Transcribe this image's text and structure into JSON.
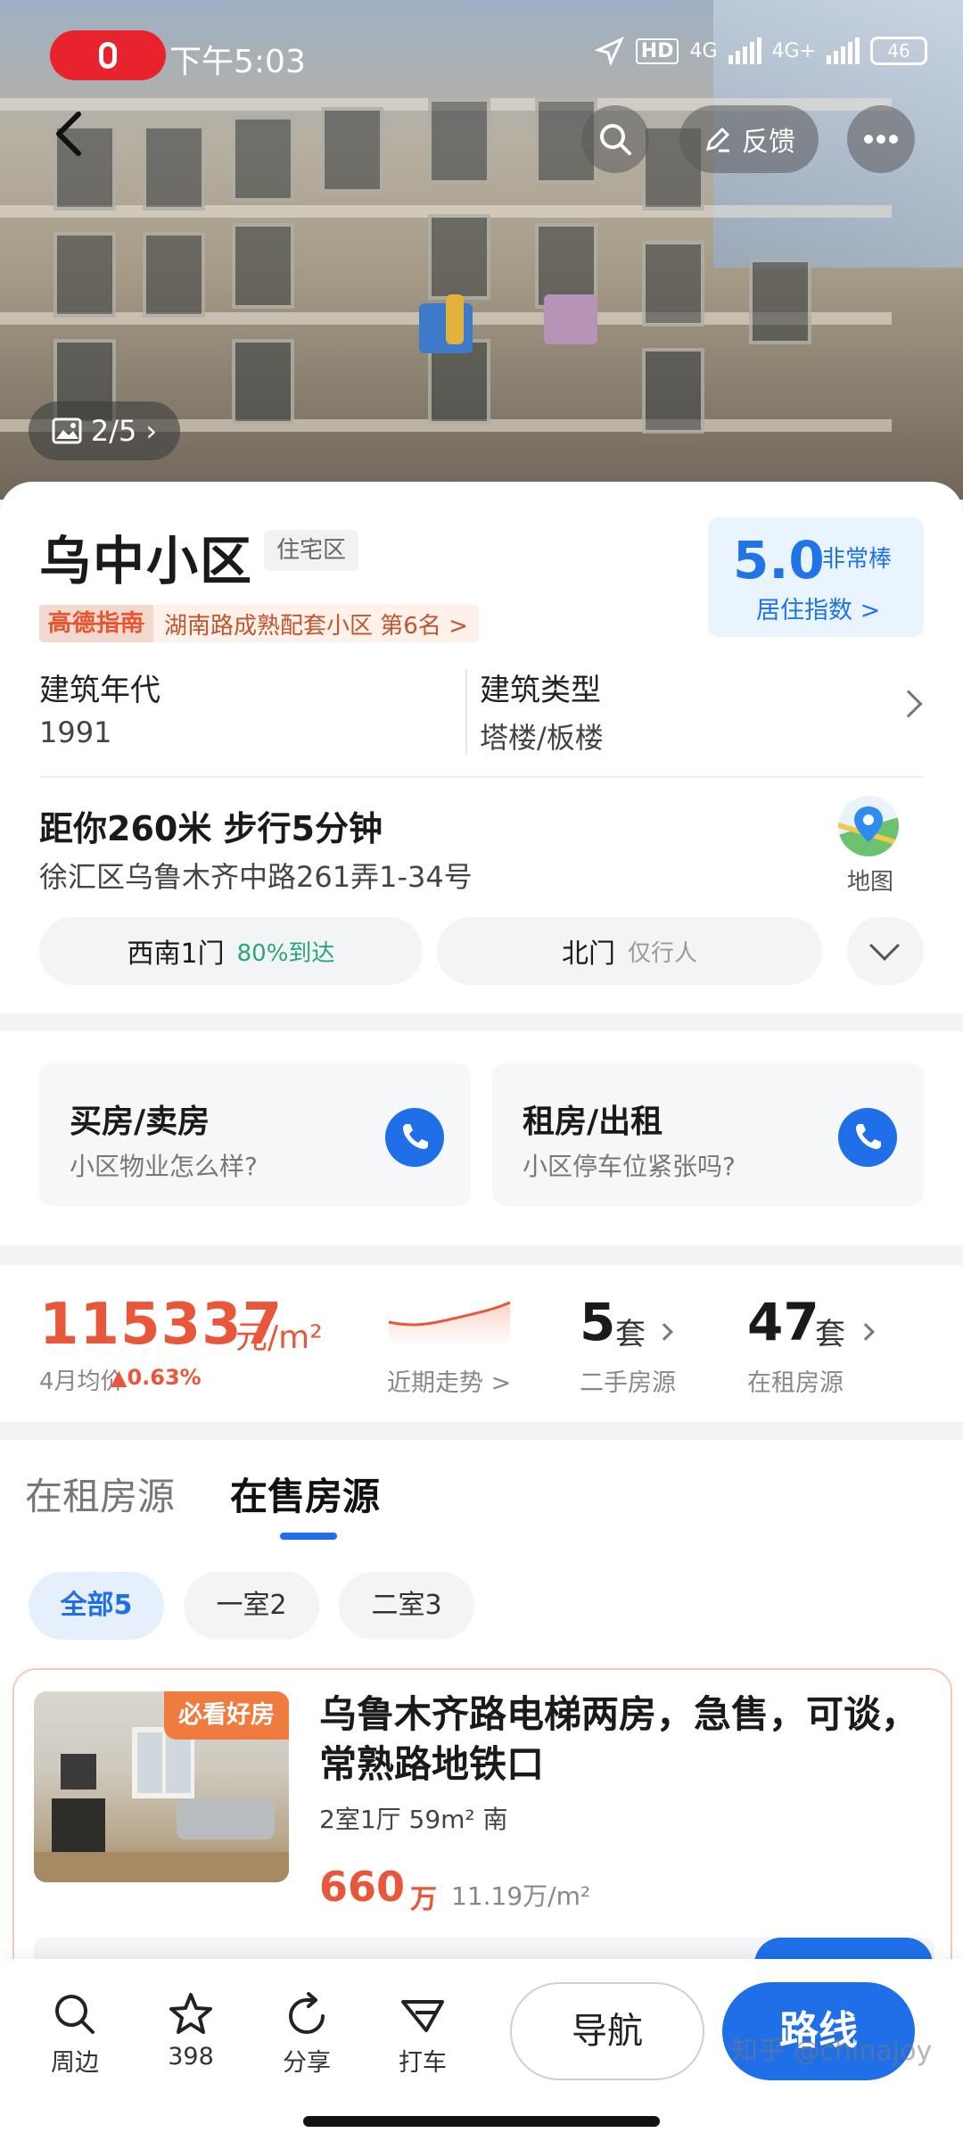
{
  "status_bar": {
    "time": "下午5:03",
    "network_1": "4G",
    "network_2": "4G+",
    "hd": "HD",
    "battery": "46"
  },
  "top_bar": {
    "feedback_label": "反馈"
  },
  "photo_counter": "2/5",
  "community": {
    "name": "乌中小区",
    "type_tag": "住宅区",
    "rank_logo": "高德指南",
    "rank_text": "湖南路成熟配套小区 第6名 >",
    "score_value": "5.0",
    "score_label": "非常棒",
    "score_link": "居住指数 >",
    "build_year_label": "建筑年代",
    "build_year": "1991",
    "build_type_label": "建筑类型",
    "build_type": "塔楼/板楼",
    "distance": "距你260米  步行5分钟",
    "address": "徐汇区乌鲁木齐中路261弄1-34号",
    "map_label": "地图",
    "gates": [
      {
        "name": "西南1门",
        "note": "80%到达"
      },
      {
        "name": "北门",
        "note": "仅行人"
      }
    ]
  },
  "consult": [
    {
      "title": "买房/卖房",
      "subtitle": "小区物业怎么样?"
    },
    {
      "title": "租房/出租",
      "subtitle": "小区停车位紧张吗?"
    }
  ],
  "price": {
    "value": "115337",
    "unit": "元/m²",
    "month_label": "4月均价",
    "change": "▲0.63%",
    "trend_label": "近期走势 >",
    "second_hand_count": "5",
    "second_hand_unit": "套",
    "second_hand_label": "二手房源",
    "rent_count": "47",
    "rent_unit": "套",
    "rent_label": "在租房源"
  },
  "listings": {
    "tabs": [
      "在租房源",
      "在售房源"
    ],
    "active_tab": "在售房源",
    "filters": [
      "全部5",
      "一室2",
      "二室3"
    ],
    "item": {
      "badge": "必看好房",
      "title": "乌鲁木齐路电梯两房，急售，可谈，常熟路地铁口",
      "spec": "2室1厅 59m² 南",
      "price": "660",
      "price_unit": "万",
      "unit_price": "11.19万/m²"
    }
  },
  "bottom_bar": {
    "nearby": "周边",
    "favorites": "398",
    "share": "分享",
    "taxi": "打车",
    "navigate": "导航",
    "route": "路线"
  },
  "watermark": "知乎 @chinajoy",
  "colors": {
    "accent_blue": "#1f6fe8",
    "price_orange": "#e9573a",
    "record_red": "#e8232e"
  }
}
